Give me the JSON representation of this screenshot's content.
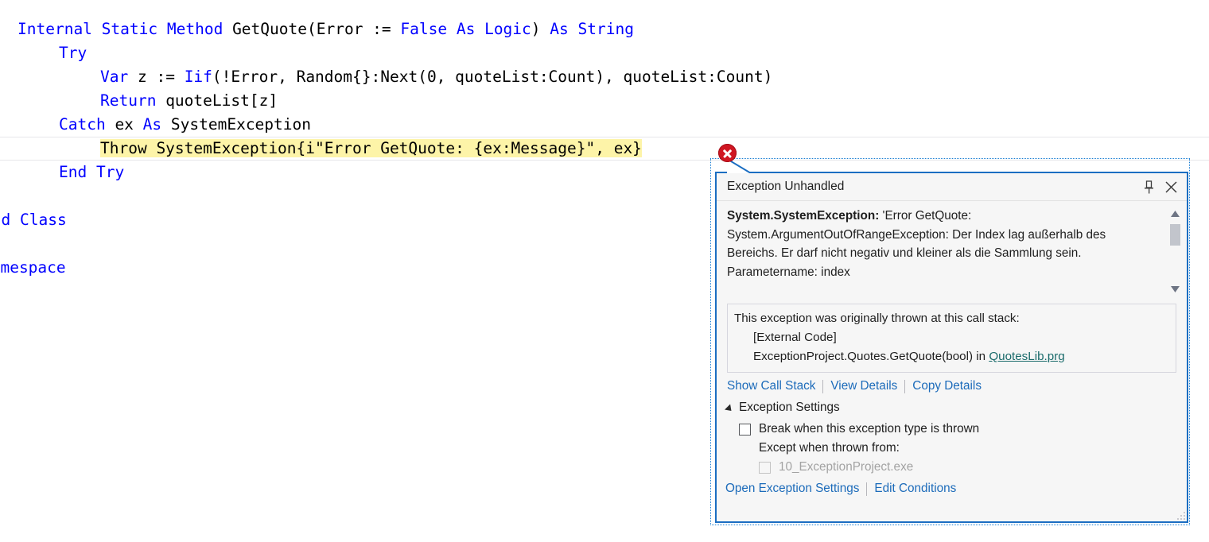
{
  "editor": {
    "code_lines": [
      {
        "indent": 22,
        "tokens": [
          {
            "t": "Internal",
            "k": true
          },
          {
            "t": " ",
            "k": false
          },
          {
            "t": "Static",
            "k": true
          },
          {
            "t": " ",
            "k": false
          },
          {
            "t": "Method",
            "k": true
          },
          {
            "t": " GetQuote(Error := ",
            "k": false
          },
          {
            "t": "False",
            "k": true
          },
          {
            "t": " ",
            "k": false
          },
          {
            "t": "As",
            "k": true
          },
          {
            "t": " ",
            "k": false
          },
          {
            "t": "Logic",
            "k": true
          },
          {
            "t": ") ",
            "k": false
          },
          {
            "t": "As",
            "k": true
          },
          {
            "t": " ",
            "k": false
          },
          {
            "t": "String",
            "k": true
          }
        ]
      },
      {
        "indent": 74,
        "tokens": [
          {
            "t": "Try",
            "k": true
          }
        ]
      },
      {
        "indent": 126,
        "tokens": [
          {
            "t": "Var",
            "k": true
          },
          {
            "t": " z := ",
            "k": false
          },
          {
            "t": "Iif",
            "k": true
          },
          {
            "t": "(!Error, Random{}:Next(0, quoteList:Count), quoteList:Count)",
            "k": false
          }
        ]
      },
      {
        "indent": 126,
        "tokens": [
          {
            "t": "Return",
            "k": true
          },
          {
            "t": " quoteList[z]",
            "k": false
          }
        ]
      },
      {
        "indent": 74,
        "tokens": [
          {
            "t": "Catch",
            "k": true
          },
          {
            "t": " ex ",
            "k": false
          },
          {
            "t": "As",
            "k": true
          },
          {
            "t": " SystemException",
            "k": false
          }
        ]
      },
      {
        "indent": 126,
        "highlight": true,
        "tokens": [
          {
            "t": "Throw SystemException{i\"Error GetQuote: {ex:Message}\", ex}",
            "k": false
          }
        ]
      },
      {
        "indent": 74,
        "tokens": [
          {
            "t": "End",
            "k": true
          },
          {
            "t": " ",
            "k": false
          },
          {
            "t": "Try",
            "k": true
          }
        ]
      },
      {
        "indent": 0,
        "tokens": []
      },
      {
        "indent": -22,
        "tokens": [
          {
            "t": "End",
            "k": true
          },
          {
            "t": " ",
            "k": false
          },
          {
            "t": "Class",
            "k": true
          }
        ]
      },
      {
        "indent": 0,
        "tokens": []
      },
      {
        "indent": -70,
        "tokens": [
          {
            "t": "End",
            "k": true
          },
          {
            "t": " ",
            "k": false
          },
          {
            "t": "Namespace",
            "k": true
          }
        ]
      }
    ]
  },
  "exception_popup": {
    "title": "Exception Unhandled",
    "pin_icon": "pin-icon",
    "close_icon": "close-icon",
    "error_icon": "error-circle-icon",
    "message": {
      "exception_type": "System.SystemException:",
      "detail": " 'Error GetQuote: System.ArgumentOutOfRangeException: Der Index lag außerhalb des Bereichs. Er darf nicht negativ und kleiner als die Sammlung sein.",
      "parameter_line": "Parametername: index"
    },
    "callstack": {
      "heading": "This exception was originally thrown at this call stack:",
      "frames": [
        {
          "text": "[External Code]",
          "link": null
        },
        {
          "text": "ExceptionProject.Quotes.GetQuote(bool) in ",
          "link": "QuotesLib.prg"
        }
      ]
    },
    "action_links": [
      "Show Call Stack",
      "View Details",
      "Copy Details"
    ],
    "settings": {
      "section_label": "Exception Settings",
      "break_checkbox_label": "Break when this exception type is thrown",
      "break_checkbox_checked": false,
      "except_label": "Except when thrown from:",
      "module_checkbox_label": "10_ExceptionProject.exe",
      "module_checkbox_checked": false,
      "module_checkbox_disabled": true,
      "links": [
        "Open Exception Settings",
        "Edit Conditions"
      ]
    },
    "colors": {
      "panel_border": "#1b6ec2",
      "link": "#1c6bba",
      "callstack_link": "#1a6b6b",
      "error_red": "#d01622",
      "highlight_yellow": "#fdf4a8",
      "keyword_blue": "#0000ff"
    }
  }
}
